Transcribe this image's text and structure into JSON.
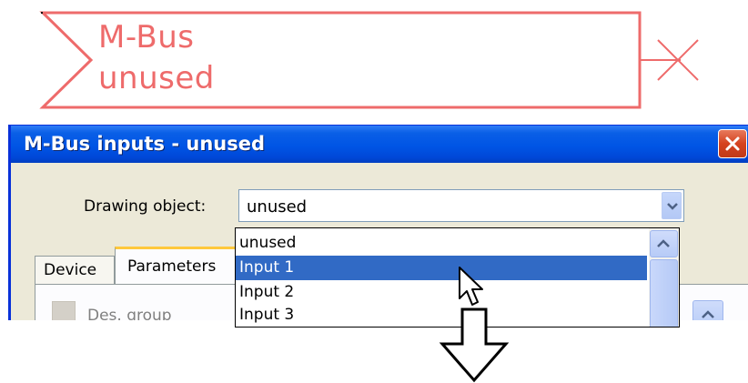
{
  "block": {
    "line1": "M-Bus",
    "line2": "unused",
    "color": "#ee6b6b"
  },
  "dialog": {
    "title": "M-Bus inputs - unused",
    "drawing_object_label": "Drawing object:",
    "drawing_object_value": "unused",
    "tabs": [
      {
        "label": "Device"
      },
      {
        "label": "Parameters"
      }
    ],
    "des_group_label": "Des. group",
    "dropdown_options": [
      {
        "label": "unused",
        "selected": false
      },
      {
        "label": "Input 1",
        "selected": true
      },
      {
        "label": "Input 2",
        "selected": false
      },
      {
        "label": "Input 3",
        "selected": false
      }
    ],
    "selection_color": "#316ac5",
    "titlebar_color": "#0055e5"
  },
  "icons": [
    "close-icon",
    "chevron-down-icon",
    "chevron-up-icon",
    "mouse-cursor-icon",
    "down-arrow-icon"
  ]
}
